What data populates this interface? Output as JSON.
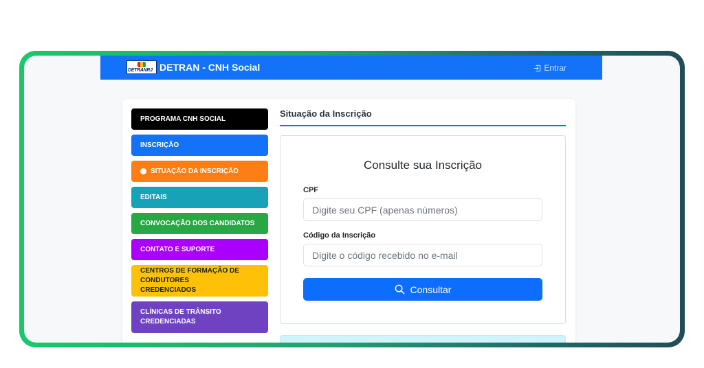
{
  "navbar": {
    "logo_text": "DETRANRJ",
    "brand": "DETRAN - CNH Social",
    "login_label": "Entrar",
    "color": "#1472f8"
  },
  "sidebar": {
    "items": [
      {
        "label": "PROGRAMA CNH SOCIAL",
        "color": "#000000"
      },
      {
        "label": "INSCRIÇÃO",
        "color": "#1472f8"
      },
      {
        "label": "SITUAÇÃO DA INSCRIÇÃO",
        "color": "#fd7e14",
        "active": true
      },
      {
        "label": "EDITAIS",
        "color": "#17a2b8"
      },
      {
        "label": "CONVOCAÇÃO DOS CANDIDATOS",
        "color": "#28a745"
      },
      {
        "label": "CONTATO E SUPORTE",
        "color": "#aa00ff"
      },
      {
        "label": "CENTROS DE FORMAÇÃO DE CONDUTORES CREDENCIADOS",
        "color": "#ffc107"
      },
      {
        "label": "CLÍNICAS DE TRÂNSITO CREDENCIADAS",
        "color": "#6f42c1"
      }
    ]
  },
  "main": {
    "section_title": "Situação da Inscrição",
    "form": {
      "title": "Consulte sua Inscrição",
      "cpf_label": "CPF",
      "cpf_placeholder": "Digite seu CPF (apenas números)",
      "code_label": "Código da Inscrição",
      "code_placeholder": "Digite o código recebido no e-mail",
      "submit_label": "Consultar"
    }
  }
}
